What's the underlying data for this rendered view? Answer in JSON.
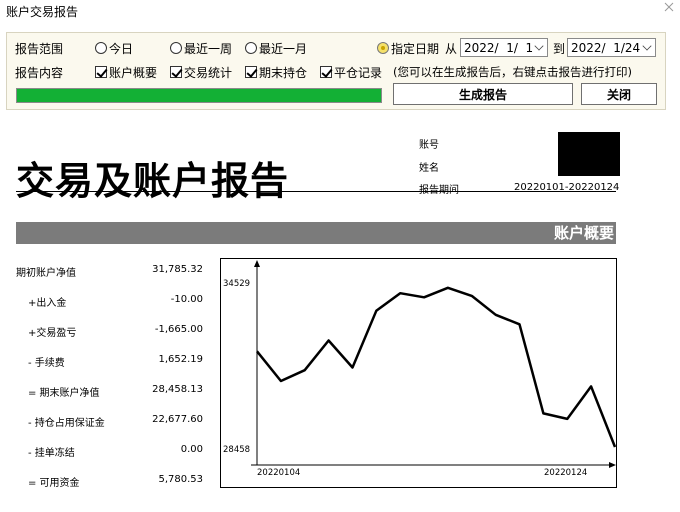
{
  "window": {
    "title": "账户交易报告"
  },
  "controls": {
    "range_label": "报告范围",
    "content_label": "报告内容",
    "ranges": [
      {
        "label": "今日",
        "selected": false
      },
      {
        "label": "最近一周",
        "selected": false
      },
      {
        "label": "最近一月",
        "selected": false
      },
      {
        "label": "指定日期",
        "selected": true
      }
    ],
    "from_label": "从",
    "from_date": "2022/  1/  1",
    "to_label": "到",
    "to_date": "2022/  1/24",
    "contents": [
      {
        "label": "账户概要",
        "checked": true
      },
      {
        "label": "交易统计",
        "checked": true
      },
      {
        "label": "期末持仓",
        "checked": true
      },
      {
        "label": "平仓记录",
        "checked": true
      }
    ],
    "hint": "(您可以在生成报告后，右键点击报告进行打印)",
    "progress": 1.0,
    "progress_color": "#13b035",
    "generate_label": "生成报告",
    "close_label": "关闭"
  },
  "report": {
    "title": "交易及账户报告",
    "account_label": "账号",
    "name_label": "姓名",
    "period_label": "报告期间",
    "period_value": "20220101-20220124",
    "section_title": "账户概要",
    "summary": [
      {
        "label": "期初账户净值",
        "value": "31,785.32"
      },
      {
        "label": "+出入金",
        "value": "-10.00"
      },
      {
        "label": "+交易盈亏",
        "value": "-1,665.00"
      },
      {
        "label": "- 手续费",
        "value": "1,652.19"
      },
      {
        "label": "= 期末账户净值",
        "value": "28,458.13"
      },
      {
        "label": "- 持仓占用保证金",
        "value": "22,677.60"
      },
      {
        "label": "- 挂单冻结",
        "value": "0.00"
      },
      {
        "label": "= 可用资金",
        "value": "5,780.53"
      }
    ]
  },
  "chart_data": {
    "type": "line",
    "title": "",
    "xlabel": "",
    "ylabel": "",
    "x_tick_labels": [
      "20220104",
      "20220124"
    ],
    "y_tick_labels": [
      "34529",
      "28458"
    ],
    "ylim": [
      28458,
      34529
    ],
    "grid": false,
    "series": [
      {
        "values": [
          32000,
          30900,
          31300,
          32400,
          31400,
          33500,
          34150,
          34000,
          34350,
          34050,
          33350,
          33000,
          29700,
          29500,
          30700,
          28458
        ]
      }
    ]
  }
}
